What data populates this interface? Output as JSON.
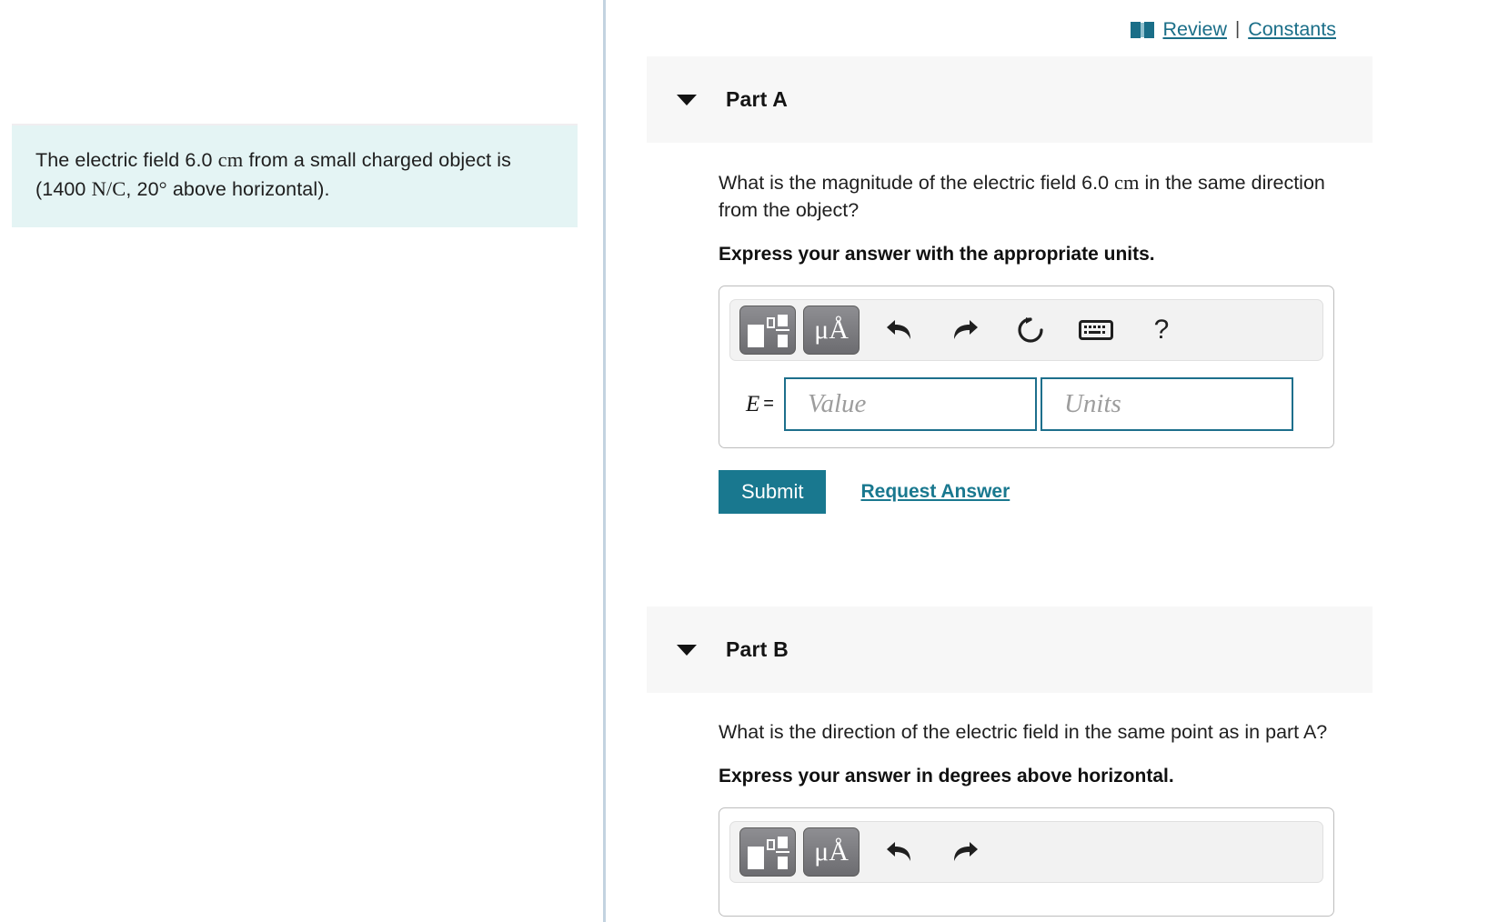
{
  "top_links": {
    "book_icon": "book-icon",
    "review_label": "Review",
    "separator": "|",
    "constants_label": "Constants"
  },
  "problem": {
    "line1_a": "The electric field 6.0 ",
    "line1_unit": "cm",
    "line1_b": " from a small charged object is (1400 ",
    "field_unit": "N/C",
    "line1_c": ", 20",
    "degree": "°",
    "line1_d": " above horizontal)."
  },
  "toolbar": {
    "template_button": "template-icon",
    "units_button": "μÅ",
    "undo_button": "undo-arrow",
    "redo_button": "redo-arrow",
    "reset_button": "reset-circle",
    "keyboard_button": "keyboard",
    "help_button": "?"
  },
  "parts": [
    {
      "id": "a",
      "title": "Part A",
      "caret": "chevron-down-icon",
      "question": "What is the magnitude of the electric field 6.0 cm in the same direction from the object?",
      "question_pre": "What is the magnitude of the electric field 6.0 ",
      "question_unit": "cm",
      "question_post": " in the same direction from the object?",
      "instruction": "Express your answer with the appropriate units.",
      "answer": {
        "label": "E",
        "equals": "=",
        "value_placeholder": "Value",
        "units_placeholder": "Units",
        "value": "",
        "units": ""
      },
      "submit_label": "Submit",
      "request_answer_label": "Request Answer"
    },
    {
      "id": "b",
      "title": "Part B",
      "caret": "chevron-down-icon",
      "question": "What is the direction of the electric field in the same point as in part A?",
      "instruction": "Express your answer in degrees above horizontal."
    }
  ],
  "colors": {
    "accent_teal": "#19788f",
    "problem_bg": "#e4f4f4",
    "panel_header_bg": "#f7f7f7",
    "divider": "#c3d3e0",
    "input_border": "#1d6f8c"
  }
}
